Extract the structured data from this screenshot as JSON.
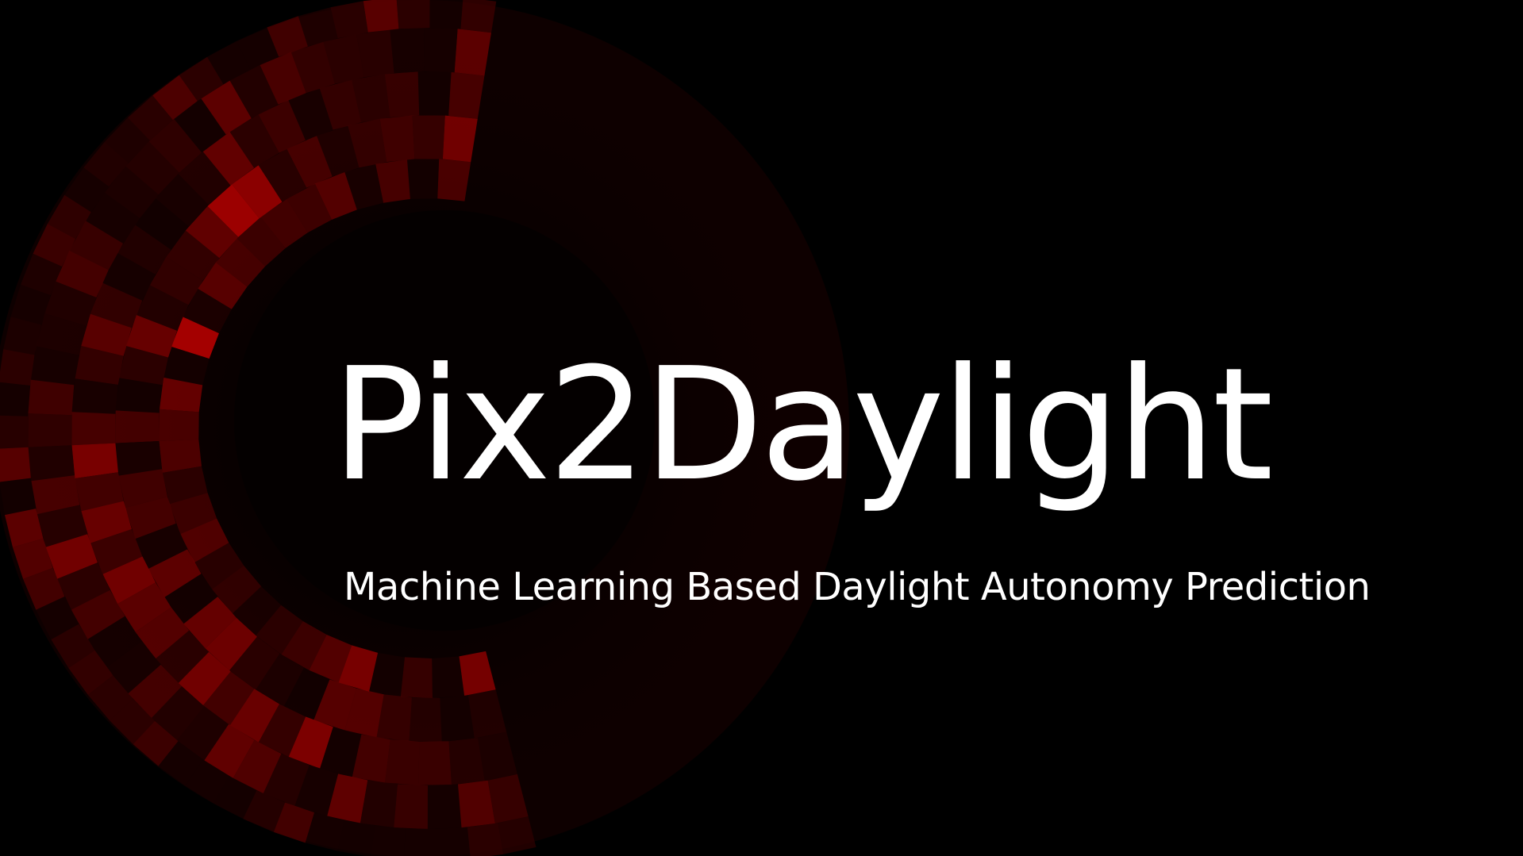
{
  "slide": {
    "title": "Pix2Daylight",
    "subtitle": "Machine Learning Based Daylight Autonomy Prediction"
  },
  "theme": {
    "background": "#000000",
    "text": "#ffffff",
    "accent": "#8b0000"
  },
  "graphic": {
    "name": "daylight-autonomy-dome-graphic",
    "palette": [
      "#1a0000",
      "#2e0000",
      "#470000",
      "#600000",
      "#7a0000",
      "#960000",
      "#b00000"
    ]
  }
}
